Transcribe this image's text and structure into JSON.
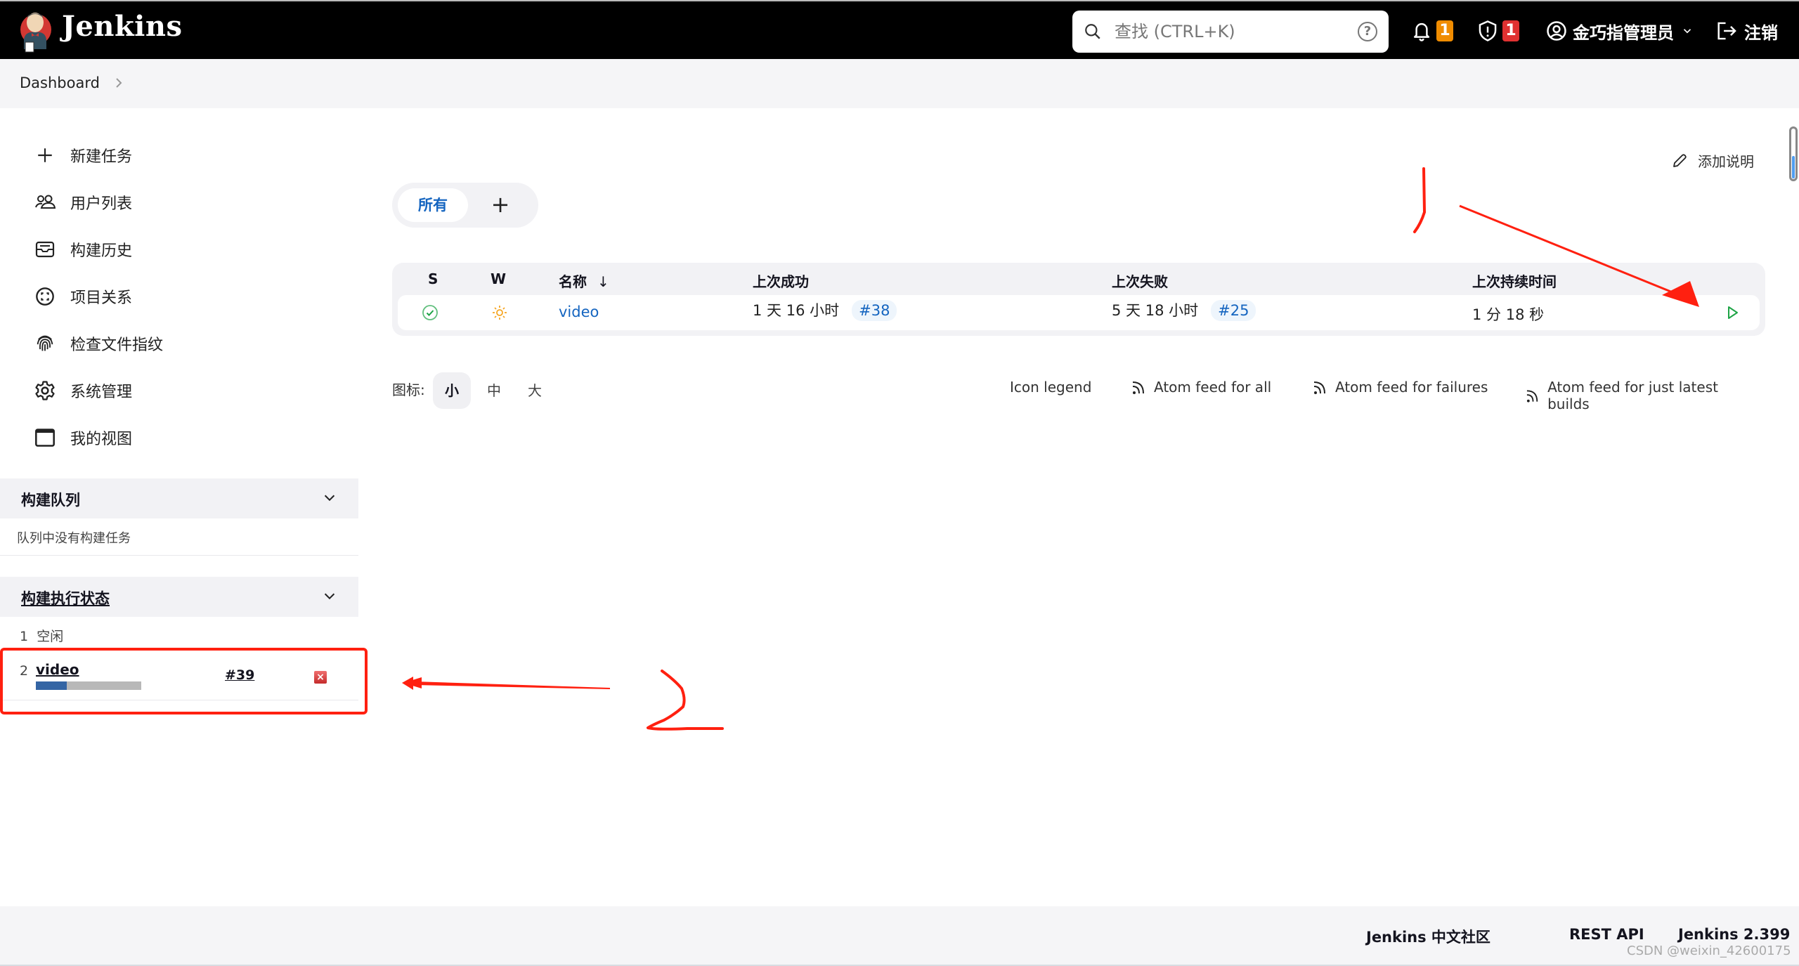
{
  "header": {
    "brand": "Jenkins",
    "search": {
      "placeholder": "查找 (CTRL+K)",
      "value": "",
      "help": "?"
    },
    "notifications_count": "1",
    "security_count": "1",
    "user_name": "金巧指管理员",
    "logout_label": "注销",
    "colors": {
      "notification_badge": "#f08c00",
      "security_badge": "#e03131"
    }
  },
  "breadcrumb": {
    "items": [
      "Dashboard"
    ]
  },
  "sidebar": {
    "items": [
      {
        "label": "新建任务",
        "icon": "plus-icon"
      },
      {
        "label": "用户列表",
        "icon": "users-icon"
      },
      {
        "label": "构建历史",
        "icon": "inbox-icon"
      },
      {
        "label": "项目关系",
        "icon": "relationship-icon"
      },
      {
        "label": "检查文件指纹",
        "icon": "fingerprint-icon"
      },
      {
        "label": "系统管理",
        "icon": "gear-icon"
      },
      {
        "label": "我的视图",
        "icon": "window-icon"
      }
    ],
    "build_queue": {
      "title": "构建队列",
      "empty_text": "队列中没有构建任务"
    },
    "executors": {
      "title": "构建执行状态",
      "items": [
        {
          "number": "1",
          "status": "空闲"
        },
        {
          "number": "2",
          "job": "video",
          "build": "#39",
          "progress_percent": 29
        }
      ]
    }
  },
  "main": {
    "add_description": "添加说明",
    "tabs": {
      "all": "所有",
      "add": "+"
    },
    "table": {
      "headers": {
        "s": "S",
        "w": "W",
        "name": "名称",
        "sort": "↓",
        "last_success": "上次成功",
        "last_failure": "上次失败",
        "last_duration": "上次持续时间"
      },
      "rows": [
        {
          "status": "success",
          "weather": "sunny",
          "name": "video",
          "last_success": "1 天 16 小时",
          "last_success_build": "#38",
          "last_failure": "5 天 18 小时",
          "last_failure_build": "#25",
          "last_duration": "1 分 18 秒"
        }
      ]
    },
    "icon_size": {
      "label": "图标:",
      "options": [
        "小",
        "中",
        "大"
      ],
      "selected": "小"
    },
    "legend_link": "Icon legend",
    "feeds": [
      "Atom feed for all",
      "Atom feed for failures",
      "Atom feed for just latest builds"
    ]
  },
  "footer": {
    "community": "Jenkins 中文社区",
    "rest_api": "REST API",
    "version": "Jenkins 2.399"
  },
  "watermark": "CSDN @weixin_42600175",
  "annotations": {
    "label_1": "1",
    "label_2": "2",
    "color": "#ff2010"
  }
}
